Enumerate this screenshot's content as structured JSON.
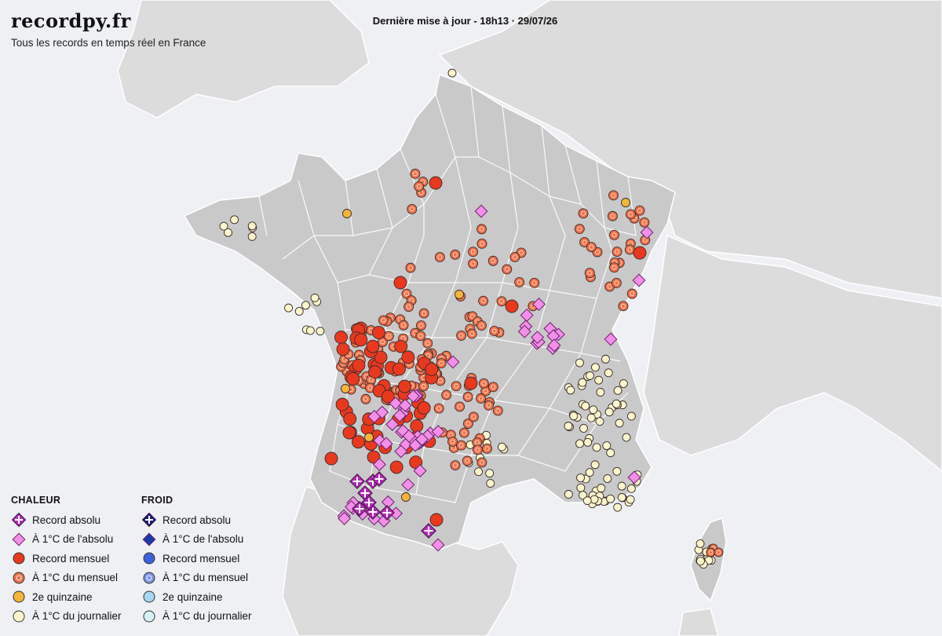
{
  "header": {
    "brand": "recordpy.fr",
    "tagline": "Tous les records en temps réel en France",
    "update": "Dernière mise à jour - 18h13 · 29/07/26"
  },
  "legend": {
    "hot": {
      "title": "CHALEUR",
      "items": [
        {
          "label": "Record absolu",
          "symbol": "cross-diamond",
          "color": "#b32bb8"
        },
        {
          "label": "À 1°C de l'absolu",
          "symbol": "diamond",
          "color": "#f28fe6"
        },
        {
          "label": "Record mensuel",
          "symbol": "circle",
          "color": "#e8391f"
        },
        {
          "label": "À 1°C du mensuel",
          "symbol": "ring",
          "color": "#ee7048"
        },
        {
          "label": "2e quinzaine",
          "symbol": "circle",
          "color": "#f4b53a"
        },
        {
          "label": "À 1°C du journalier",
          "symbol": "circle",
          "color": "#fbf6cc"
        }
      ]
    },
    "cold": {
      "title": "FROID",
      "items": [
        {
          "label": "Record absolu",
          "symbol": "cross-diamond",
          "color": "#1b1f7a"
        },
        {
          "label": "À 1°C de l'absolu",
          "symbol": "diamond",
          "color": "#1a3aa6"
        },
        {
          "label": "Record mensuel",
          "symbol": "circle",
          "color": "#3c62dd"
        },
        {
          "label": "À 1°C du mensuel",
          "symbol": "ring",
          "color": "#7f95e8"
        },
        {
          "label": "2e quinzaine",
          "symbol": "circle",
          "color": "#a9d6f2"
        },
        {
          "label": "À 1°C du journalier",
          "symbol": "circle",
          "color": "#d4f0f4"
        }
      ]
    }
  },
  "colors": {
    "sea": "#eef0f3",
    "land_neighbor": "#dcdcdc",
    "france": "#c9c9c9",
    "borders": "#ffffff"
  }
}
